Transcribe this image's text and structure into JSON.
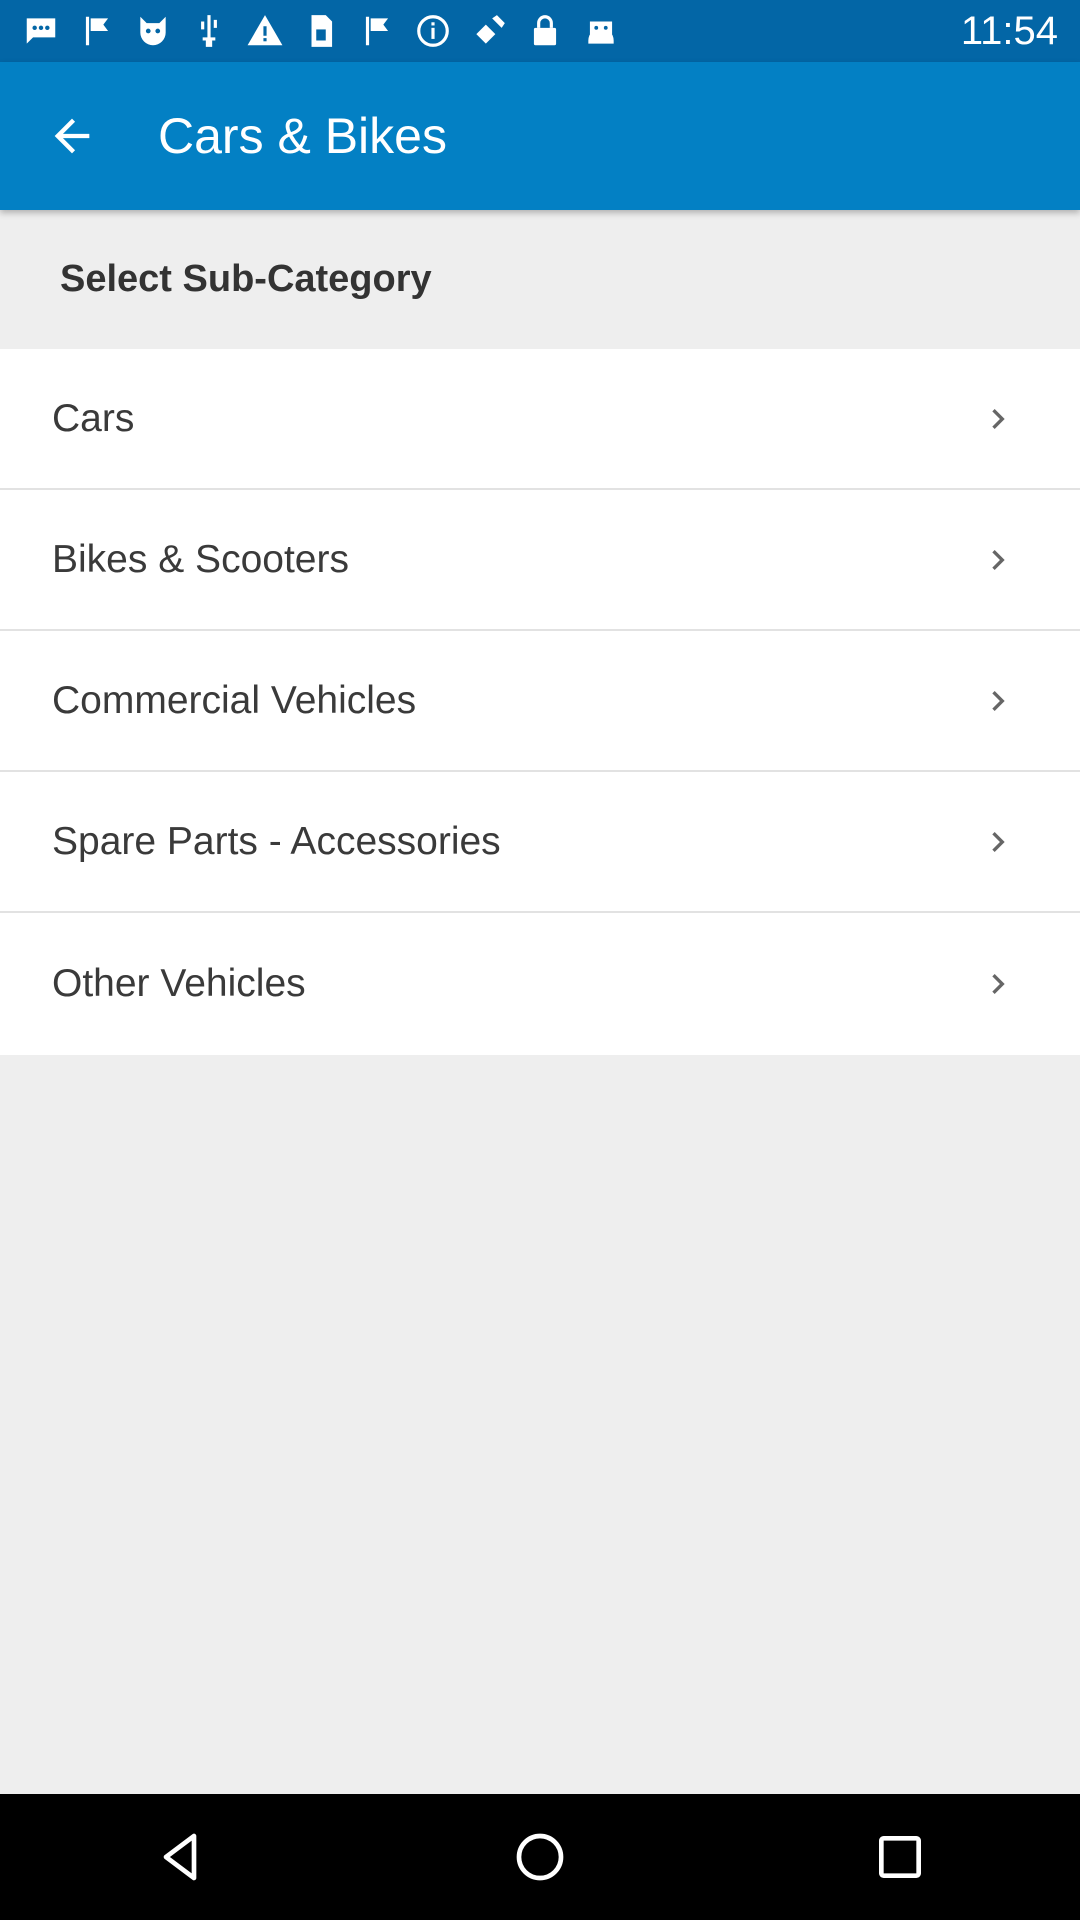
{
  "status_bar": {
    "time": "11:54",
    "icons": [
      "chat-icon",
      "flag-icon",
      "cat-icon",
      "usb-icon",
      "warning-icon",
      "sim-icon",
      "flag-icon",
      "info-icon",
      "satellite-fake-icon",
      "lock-icon",
      "android-icon"
    ]
  },
  "app_bar": {
    "title": "Cars & Bikes",
    "background": "#0380c4"
  },
  "section": {
    "title": "Select Sub-Category"
  },
  "categories": [
    {
      "label": "Cars"
    },
    {
      "label": "Bikes & Scooters"
    },
    {
      "label": "Commercial Vehicles"
    },
    {
      "label": "Spare Parts - Accessories"
    },
    {
      "label": "Other Vehicles"
    }
  ],
  "nav_bar": {
    "buttons": [
      "back-triangle-icon",
      "home-circle-icon",
      "recents-square-icon"
    ]
  }
}
